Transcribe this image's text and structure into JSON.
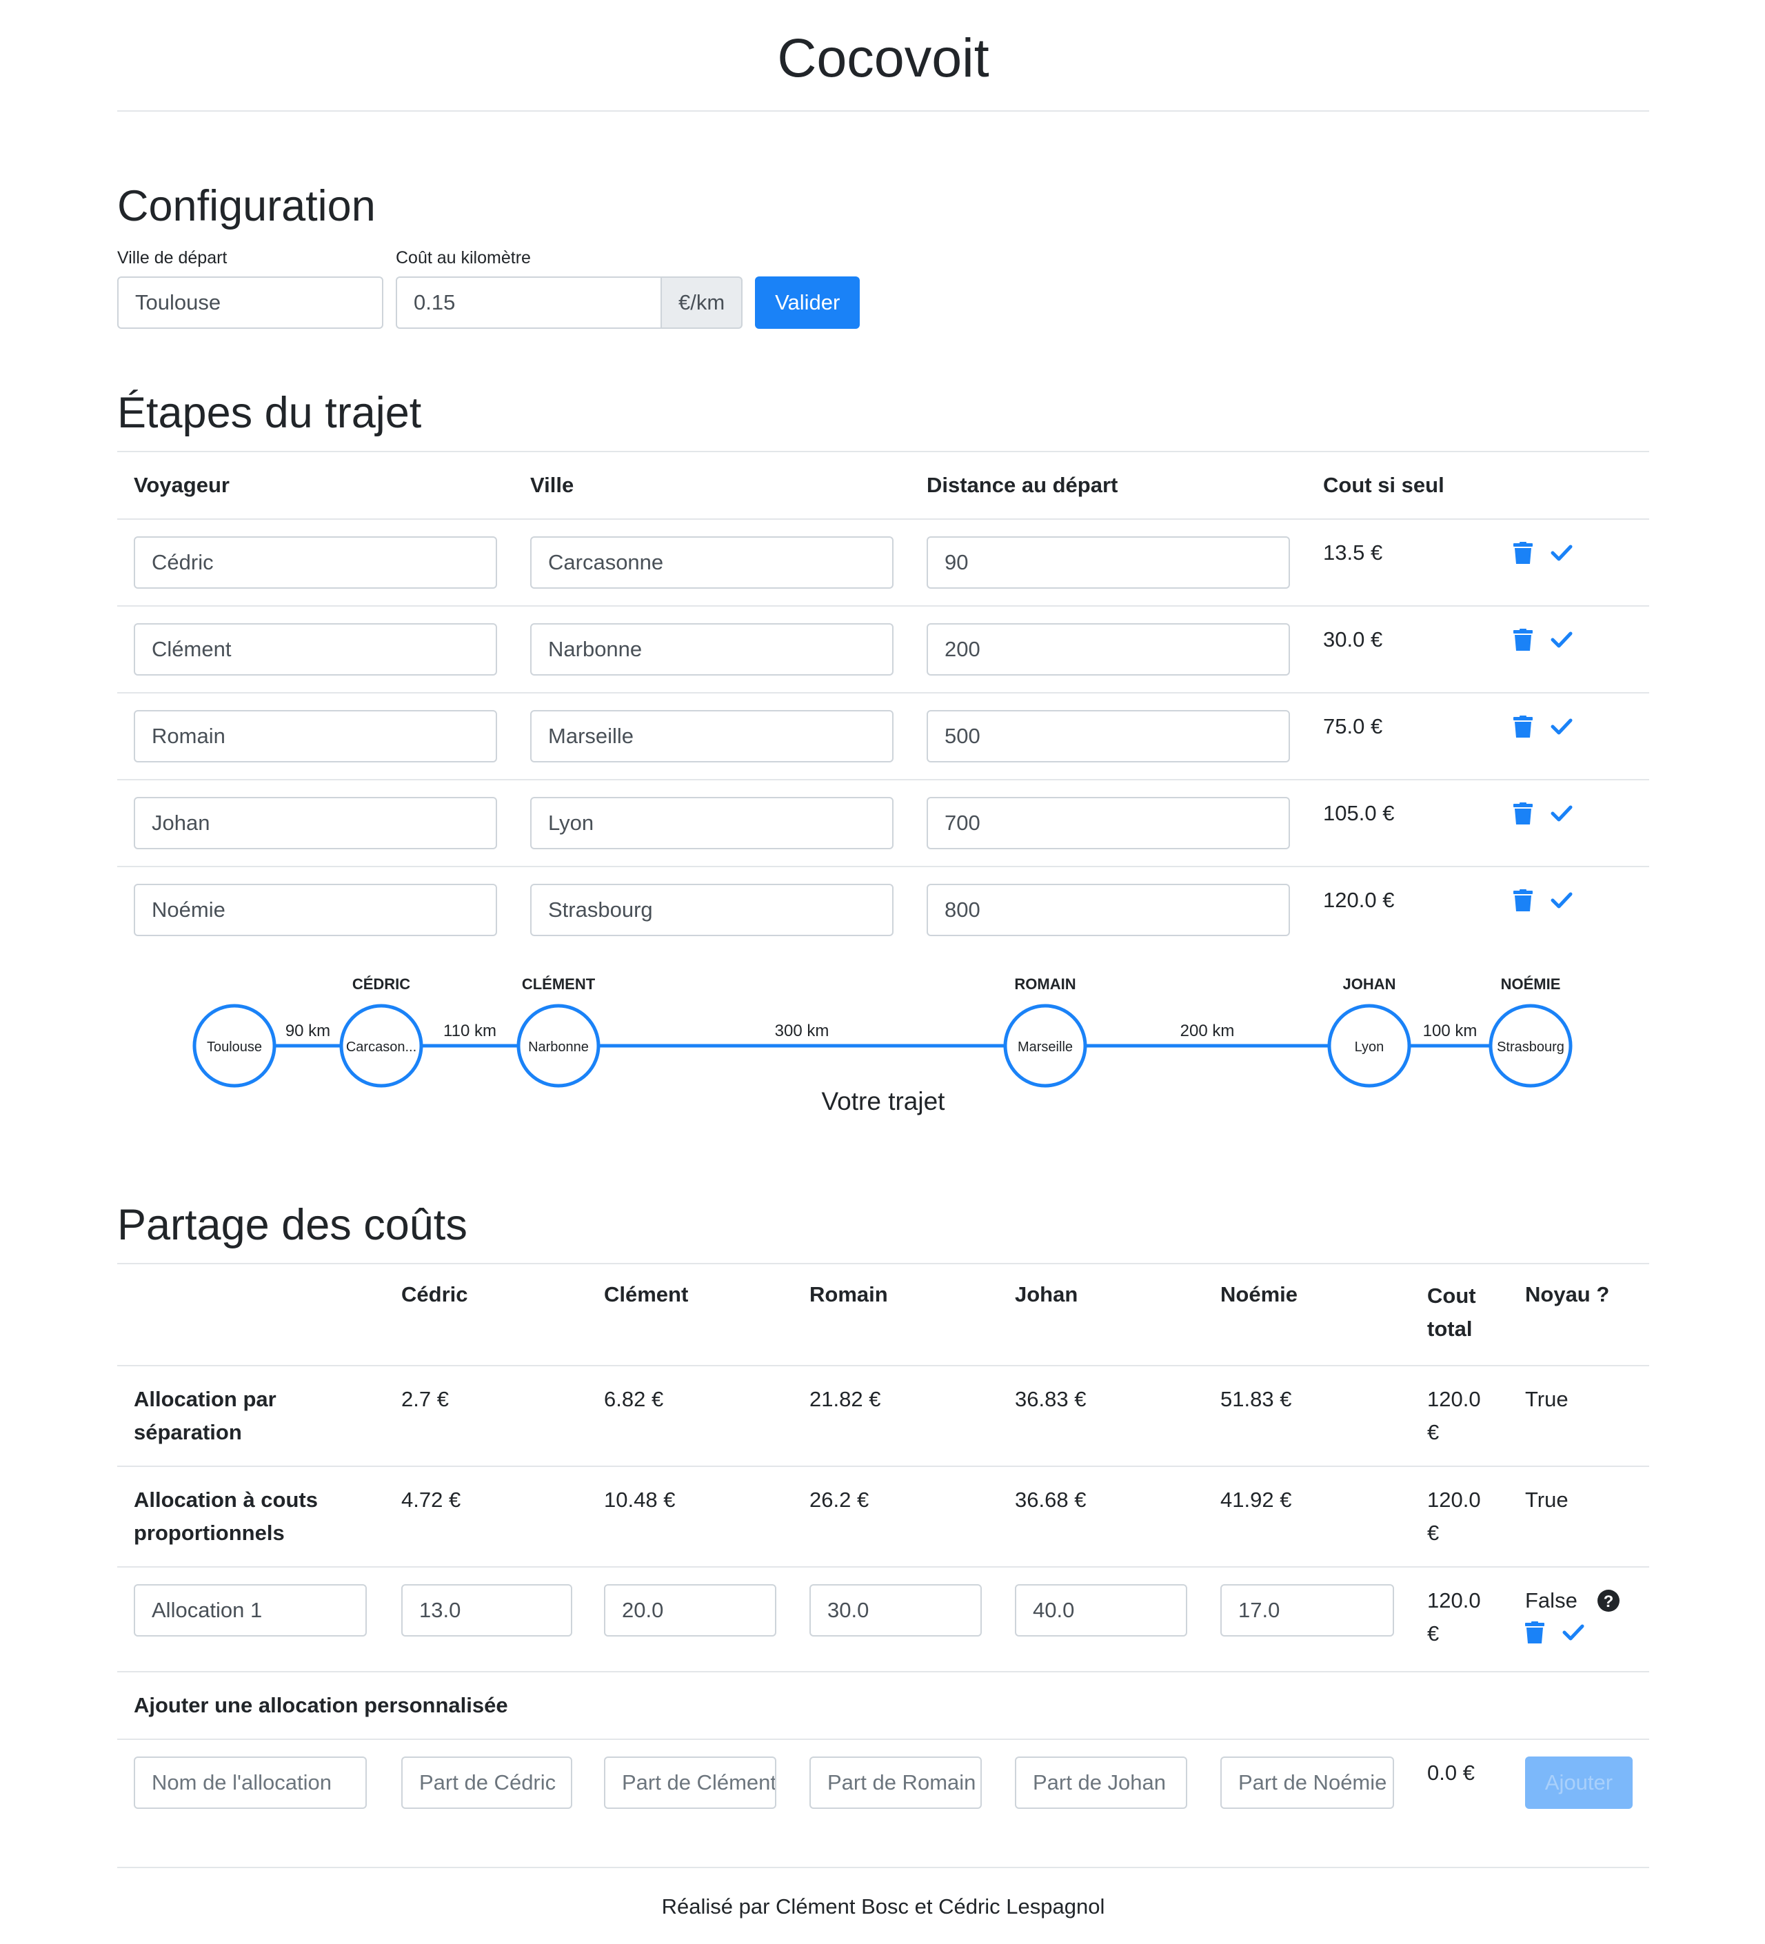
{
  "app": {
    "title": "Cocovoit"
  },
  "config": {
    "heading": "Configuration",
    "start_city_label": "Ville de départ",
    "start_city_value": "Toulouse",
    "cost_label": "Coût au kilomètre",
    "cost_value": "0.15",
    "cost_unit": "€/km",
    "validate_label": "Valider"
  },
  "steps": {
    "heading": "Étapes du trajet",
    "headers": [
      "Voyageur",
      "Ville",
      "Distance au départ",
      "Cout si seul"
    ],
    "rows": [
      {
        "traveler": "Cédric",
        "city": "Carcasonne",
        "distance": "90",
        "cost": "13.5 €"
      },
      {
        "traveler": "Clément",
        "city": "Narbonne",
        "distance": "200",
        "cost": "30.0 €"
      },
      {
        "traveler": "Romain",
        "city": "Marseille",
        "distance": "500",
        "cost": "75.0 €"
      },
      {
        "traveler": "Johan",
        "city": "Lyon",
        "distance": "700",
        "cost": "105.0 €"
      },
      {
        "traveler": "Noémie",
        "city": "Strasbourg",
        "distance": "800",
        "cost": "120.0 €"
      }
    ]
  },
  "route": {
    "caption": "Votre trajet",
    "nodes": [
      {
        "name": "",
        "city": "Toulouse"
      },
      {
        "name": "CÉDRIC",
        "city": "Carcason..."
      },
      {
        "name": "CLÉMENT",
        "city": "Narbonne"
      },
      {
        "name": "ROMAIN",
        "city": "Marseille"
      },
      {
        "name": "JOHAN",
        "city": "Lyon"
      },
      {
        "name": "NOÉMIE",
        "city": "Strasbourg"
      }
    ],
    "segments": [
      "90 km",
      "110 km",
      "300 km",
      "200 km",
      "100 km"
    ]
  },
  "sharing": {
    "heading": "Partage des coûts",
    "headers": [
      "",
      "Cédric",
      "Clément",
      "Romain",
      "Johan",
      "Noémie",
      "Cout total",
      "Noyau ?"
    ],
    "rows": [
      {
        "label": "Allocation par séparation",
        "values": [
          "2.7 €",
          "6.82 €",
          "21.82 €",
          "36.83 €",
          "51.83 €"
        ],
        "total": "120.0 €",
        "core": "True"
      },
      {
        "label": "Allocation à couts proportionnels",
        "values": [
          "4.72 €",
          "10.48 €",
          "26.2 €",
          "36.68 €",
          "41.92 €"
        ],
        "total": "120.0 €",
        "core": "True"
      }
    ],
    "custom": {
      "label": "Allocation 1",
      "values": [
        "13.0",
        "20.0",
        "30.0",
        "40.0",
        "17.0"
      ],
      "total": "120.0 €",
      "core": "False",
      "help_icon": "question-circle-icon"
    },
    "add_heading": "Ajouter une allocation personnalisée",
    "add_row": {
      "placeholders": [
        "Nom de l'allocation",
        "Part de Cédric",
        "Part de Clément",
        "Part de Romain",
        "Part de Johan",
        "Part de Noémie"
      ],
      "total": "0.0 €",
      "button": "Ajouter"
    }
  },
  "footer": {
    "text": "Réalisé par Clément Bosc et Cédric Lespagnol"
  },
  "colors": {
    "primary": "#1a82f7",
    "disabled_button": "#7cb8fa",
    "border": "#ced4da",
    "addon_bg": "#e9ecef"
  },
  "icons": {
    "delete": "trash-icon",
    "confirm": "check-icon",
    "help": "question-circle-icon"
  }
}
